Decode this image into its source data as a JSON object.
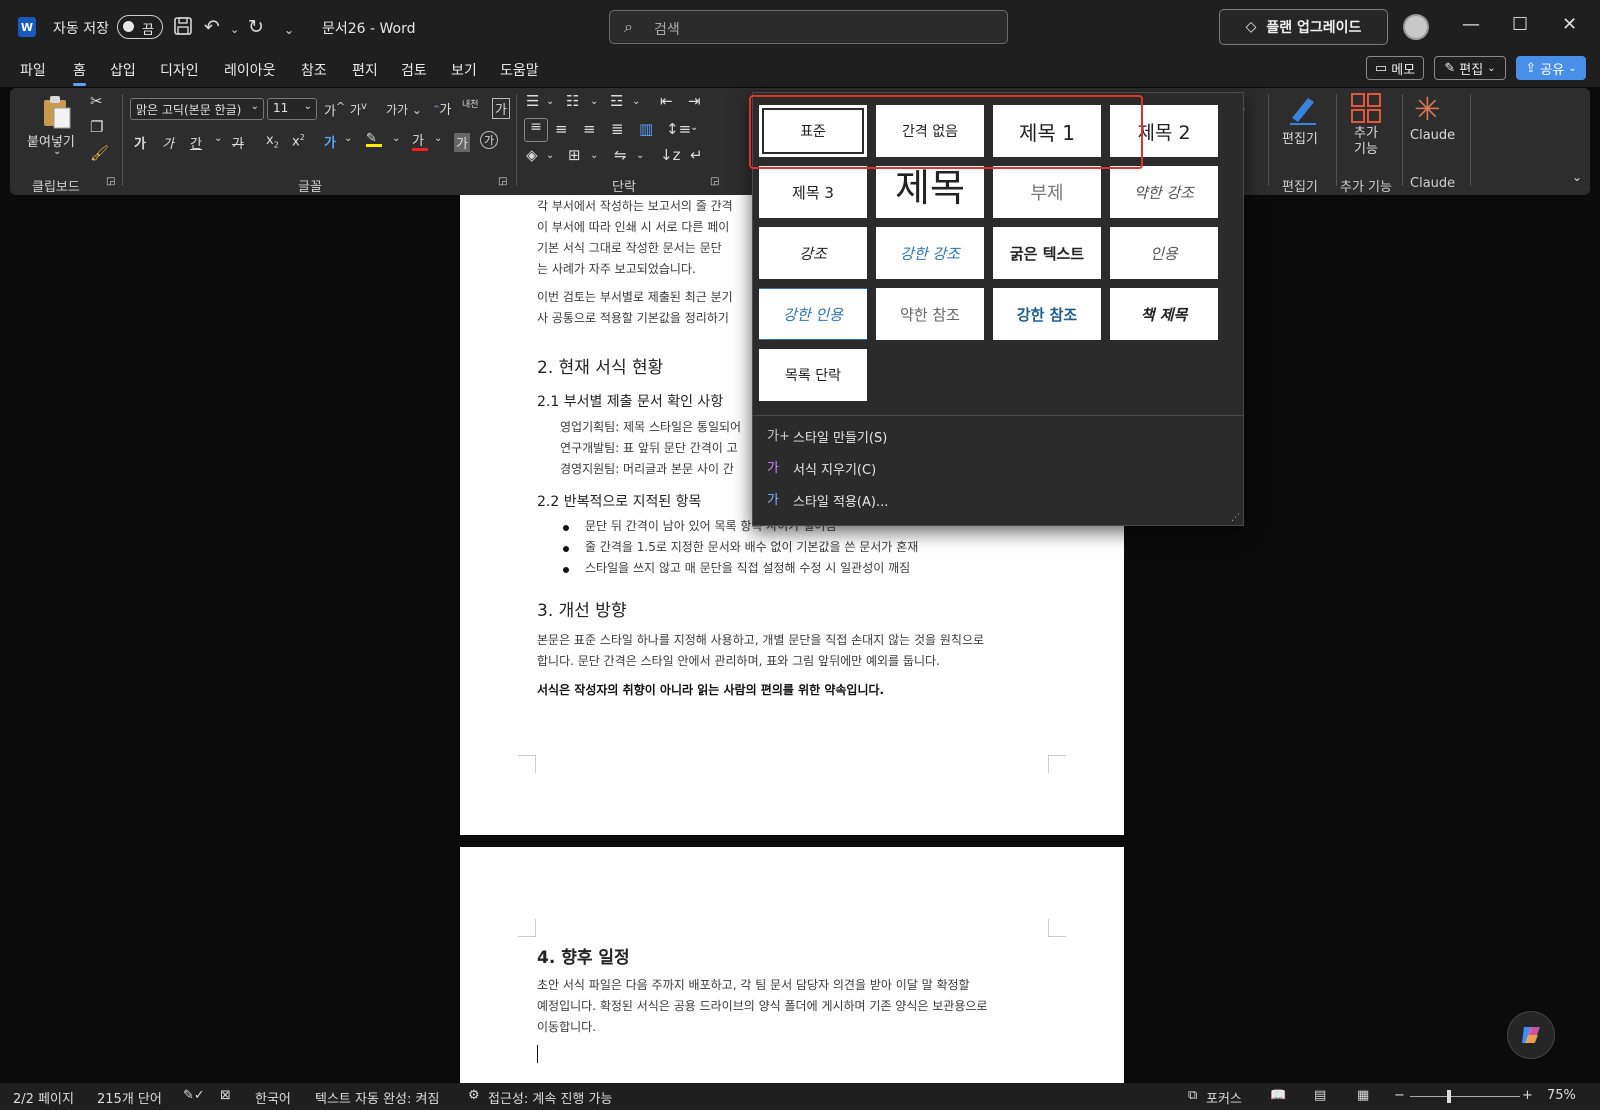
{
  "titlebar": {
    "logo": "W",
    "autosave_label": "자동 저장",
    "autosave_state": "끔",
    "doc_title": "문서26  -  Word",
    "search_placeholder": "검색",
    "upgrade_label": "플랜 업그레이드"
  },
  "menu": {
    "tabs": [
      "파일",
      "홈",
      "삽입",
      "디자인",
      "레이아웃",
      "참조",
      "편지",
      "검토",
      "보기",
      "도움말"
    ],
    "active": "홈",
    "memo": "메모",
    "edit": "편집",
    "share": "공유"
  },
  "ribbon": {
    "clipboard": {
      "paste": "붙여넣기",
      "label": "클립보드"
    },
    "font": {
      "name": "맑은 고딕(본문 한글)",
      "size": "11",
      "label": "글꼴",
      "grow": "가",
      "shrink": "가",
      "case": "가가",
      "hanja": "내천",
      "bold": "가",
      "italic": "가",
      "underline": "간",
      "strike": "가",
      "sub": "x",
      "sup": "x",
      "effect": "가",
      "color": "가",
      "shade": "가",
      "enclose": "가"
    },
    "paragraph": {
      "label": "단락"
    },
    "editor": {
      "label": "편집기",
      "group": "편집기"
    },
    "addins": {
      "label": "추가 기능",
      "label_line1": "추가",
      "label_line2": "기능",
      "group": "추가 기능"
    },
    "claude": {
      "label": "Claude",
      "group": "Claude"
    }
  },
  "gallery": {
    "styles": [
      {
        "label": "표준"
      },
      {
        "label": "간격 없음"
      },
      {
        "label": "제목 1"
      },
      {
        "label": "제목 2"
      },
      {
        "label": "제목 3"
      },
      {
        "label": "제목"
      },
      {
        "label": "부제"
      },
      {
        "label": "약한 강조"
      },
      {
        "label": "강조"
      },
      {
        "label": "강한 강조"
      },
      {
        "label": "굵은 텍스트"
      },
      {
        "label": "인용"
      },
      {
        "label": "강한 인용"
      },
      {
        "label": "약한 참조"
      },
      {
        "label": "강한 참조"
      },
      {
        "label": "책 제목"
      },
      {
        "label": "목록 단락"
      }
    ],
    "commands": [
      {
        "label": "스타일 만들기(S)",
        "icon": "가+"
      },
      {
        "label": "서식 지우기(C)",
        "icon": "가"
      },
      {
        "label": "스타일 적용(A)...",
        "icon": "가"
      }
    ]
  },
  "document": {
    "p1_lines": [
      "각 부서에서 작성하는 보고서의 줄 간격",
      "이 부서에 따라 인쇄 시 서로 다른 페이",
      "기본 서식 그대로 작성한 문서는 문단",
      "는 사례가 자주 보고되었습니다."
    ],
    "p2_lines": [
      "이번 검토는 부서별로 제출된 최근 분기",
      "사 공통으로 적용할 기본값을 정리하기"
    ],
    "h1_2": "2. 현재 서식 현황",
    "h2_21": "2.1 부서별 제출 문서 확인 사항",
    "dept_lines": [
      "영업기획팀: 제목 스타일은 통일되어",
      "연구개발팀: 표 앞뒤 문단 간격이 고",
      "경영지원팀: 머리글과 본문 사이 간"
    ],
    "h2_22": "2.2 반복적으로 지적된 항목",
    "bullets": [
      "문단 뒤 간격이 남아 있어 목록 항목 사이가 벌어짐",
      "줄 간격을 1.5로 지정한 문서와 배수 없이 기본값을 쓴 문서가 혼재",
      "스타일을 쓰지 않고 매 문단을 직접 설정해 수정 시 일관성이 깨짐"
    ],
    "h1_3": "3. 개선 방향",
    "p3_lines": [
      "본문은 표준 스타일 하나를 지정해 사용하고, 개별 문단을 직접 손대지 않는 것을 원칙으로",
      "합니다. 문단 간격은 스타일 안에서 관리하며, 표와 그림 앞뒤에만 예외를 둡니다."
    ],
    "p3_bold": "서식은 작성자의 취향이 아니라 읽는 사람의 편의를 위한 약속입니다.",
    "h1_4": "4. 향후 일정",
    "p4_lines": [
      "초안 서식 파일은 다음 주까지 배포하고, 각 팀 문서 담당자 의견을 받아 이달 말 확정할",
      "예정입니다. 확정된 서식은 공용 드라이브의 양식 폴더에 게시하며 기존 양식은 보관용으로",
      "이동합니다."
    ]
  },
  "status": {
    "page": "2/2 페이지",
    "words": "215개 단어",
    "language": "한국어",
    "autocomplete": "텍스트 자동 완성: 켜짐",
    "accessibility": "접근성: 계속 진행 가능",
    "focus": "포커스",
    "zoom": "75%"
  },
  "colors": {
    "accent": "#5aa0ff",
    "highlight_box": "#e0312e",
    "share_bg": "#4a8fe7",
    "claude": "#d97757"
  }
}
